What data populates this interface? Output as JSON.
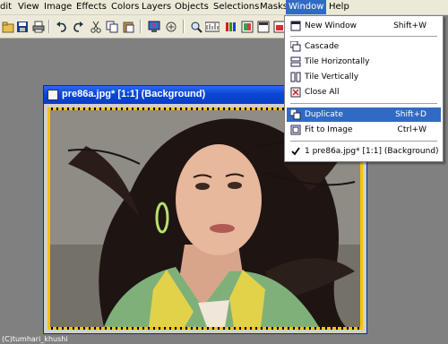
{
  "menubar": {
    "items": [
      "dit",
      "View",
      "Image",
      "Effects",
      "Colors",
      "Layers",
      "Objects",
      "Selections",
      "Masks",
      "Window",
      "Help"
    ]
  },
  "window": {
    "title": "pre86a.jpg* [1:1] (Background)"
  },
  "window_menu": {
    "items": [
      {
        "label": "New Window",
        "shortcut": "Shift+W",
        "icon": "new-window-icon"
      },
      {
        "label": "Cascade",
        "shortcut": "",
        "icon": "cascade-icon"
      },
      {
        "label": "Tile Horizontally",
        "shortcut": "",
        "icon": "tile-horizontal-icon"
      },
      {
        "label": "Tile Vertically",
        "shortcut": "",
        "icon": "tile-vertical-icon"
      },
      {
        "label": "Close All",
        "shortcut": "",
        "icon": "close-all-icon"
      },
      {
        "label": "Duplicate",
        "shortcut": "Shift+D",
        "icon": "duplicate-icon",
        "highlighted": true
      },
      {
        "label": "Fit to Image",
        "shortcut": "Ctrl+W",
        "icon": "fit-to-image-icon"
      },
      {
        "label": "1 pre86a.jpg* [1:1] (Background)",
        "shortcut": "",
        "icon": "check-icon",
        "checked": true
      }
    ]
  },
  "watermark": "(C)tumhari_khushi",
  "colors": {
    "highlight": "#316ac5",
    "titlebar": "#0a46d6",
    "menubar": "#ece9d8"
  }
}
